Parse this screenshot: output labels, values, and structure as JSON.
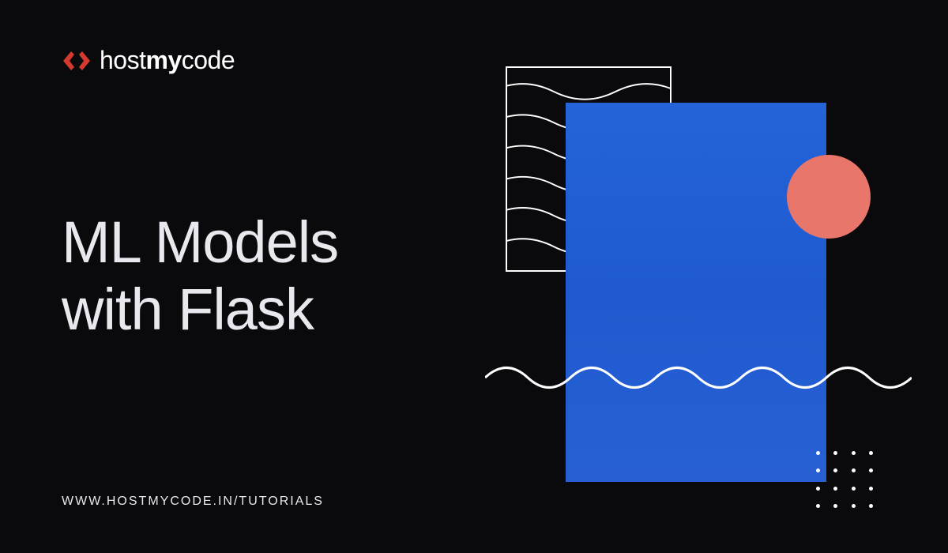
{
  "brand": {
    "name_light1": "host",
    "name_bold": "my",
    "name_light2": "code",
    "accent_color": "#d43a2f"
  },
  "hero": {
    "title_line1": "ML Models",
    "title_line2": "with Flask"
  },
  "footer": {
    "url": "WWW.HOSTMYCODE.IN/TUTORIALS"
  },
  "graphics": {
    "blue": "#2463d8",
    "coral": "#e8766a"
  }
}
